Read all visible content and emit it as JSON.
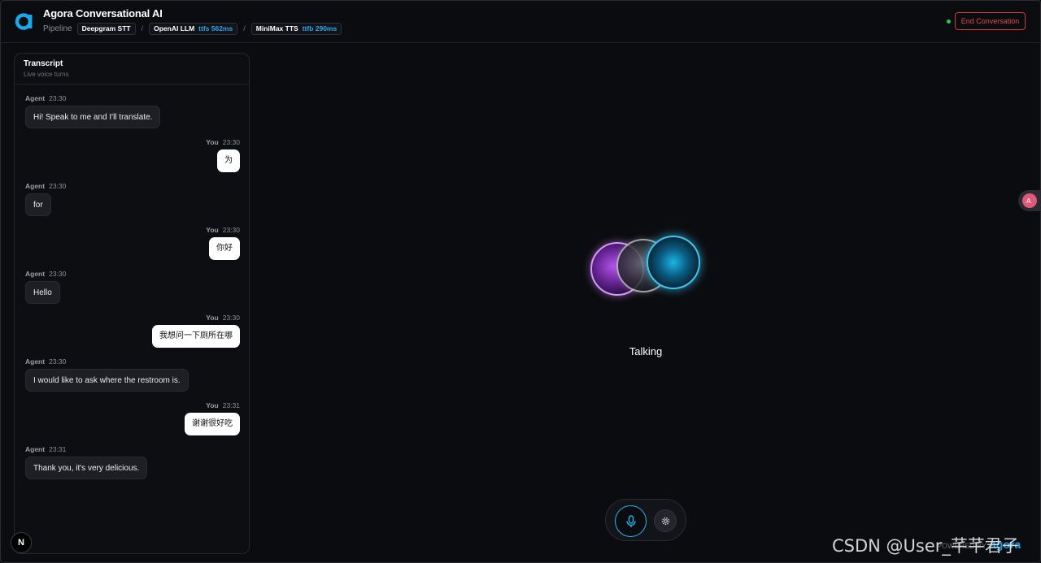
{
  "header": {
    "title": "Agora Conversational AI",
    "pipeline_label": "Pipeline",
    "stt": {
      "name": "Deepgram STT"
    },
    "llm": {
      "name": "OpenAI LLM",
      "ttfb": "ttfs 562ms"
    },
    "tts": {
      "name": "MiniMax TTS",
      "ttfb": "ttfb 290ms"
    },
    "separator": "/",
    "end_button": "End Conversation",
    "status_color": "#22c55e"
  },
  "transcript": {
    "title": "Transcript",
    "subtitle": "Live voice turns",
    "messages": [
      {
        "role": "agent",
        "who": "Agent",
        "time": "23:30",
        "text": "Hi! Speak to me and I'll translate."
      },
      {
        "role": "user",
        "who": "You",
        "time": "23:30",
        "text": "为"
      },
      {
        "role": "agent",
        "who": "Agent",
        "time": "23:30",
        "text": "for"
      },
      {
        "role": "user",
        "who": "You",
        "time": "23:30",
        "text": "你好"
      },
      {
        "role": "agent",
        "who": "Agent",
        "time": "23:30",
        "text": "Hello"
      },
      {
        "role": "user",
        "who": "You",
        "time": "23:30",
        "text": "我想问一下厕所在哪"
      },
      {
        "role": "agent",
        "who": "Agent",
        "time": "23:30",
        "text": "I would like to ask where the restroom is."
      },
      {
        "role": "user",
        "who": "You",
        "time": "23:31",
        "text": "谢谢很好吃"
      },
      {
        "role": "agent",
        "who": "Agent",
        "time": "23:31",
        "text": "Thank you, it's very delicious."
      }
    ]
  },
  "visualizer": {
    "status": "Talking",
    "orb_colors": [
      "#b04ee8",
      "#6b6d74",
      "#1bb6e6"
    ]
  },
  "controls": {
    "mic_icon": "microphone-icon",
    "settings_icon": "gear-icon"
  },
  "footer": {
    "powered_by": "POWERED BY",
    "brand": "agora",
    "watermark": "CSDN @User_芊芊君子",
    "next_badge": "N"
  }
}
